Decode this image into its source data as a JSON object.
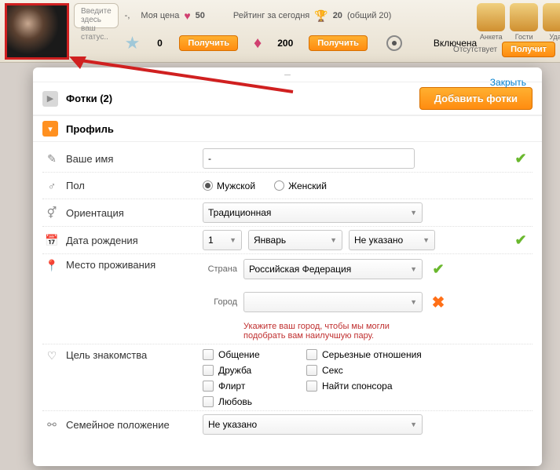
{
  "topbar": {
    "status_placeholder": "Введите здесь ваш статус..",
    "name_line": "-,",
    "price_label": "Моя цена",
    "price_value": "50",
    "rating_label": "Рейтинг за сегодня",
    "rating_value": "20",
    "rating_total": "(общий 20)",
    "star_value": "0",
    "star_btn": "Получить",
    "heart_value": "200",
    "heart_btn": "Получить",
    "eye_label": "Включена",
    "ricons": [
      {
        "label": "Анкета"
      },
      {
        "label": "Гости"
      },
      {
        "label": "Удач"
      }
    ],
    "absent_label": "Отсутствует",
    "absent_btn": "Получит"
  },
  "modal": {
    "close": "Закрыть",
    "photos_title": "Фотки (2)",
    "add_photos_btn": "Добавить фотки",
    "profile_title": "Профиль"
  },
  "form": {
    "name_label": "Ваше имя",
    "name_value": "-",
    "gender_label": "Пол",
    "gender_male": "Мужской",
    "gender_female": "Женский",
    "orientation_label": "Ориентация",
    "orientation_value": "Традиционная",
    "dob_label": "Дата рождения",
    "dob_day": "1",
    "dob_month": "Январь",
    "dob_year": "Не указано",
    "location_label": "Место проживания",
    "country_sublabel": "Страна",
    "country_value": "Российская Федерация",
    "city_sublabel": "Город",
    "city_value": "",
    "city_hint": "Укажите ваш город, чтобы мы могли подобрать вам наилучшую пару.",
    "purpose_label": "Цель знакомства",
    "purpose_opts": [
      "Общение",
      "Серьезные отношения",
      "Дружба",
      "Секс",
      "Флирт",
      "Найти спонсора",
      "Любовь"
    ],
    "marital_label": "Семейное положение",
    "marital_value": "Не указано"
  }
}
